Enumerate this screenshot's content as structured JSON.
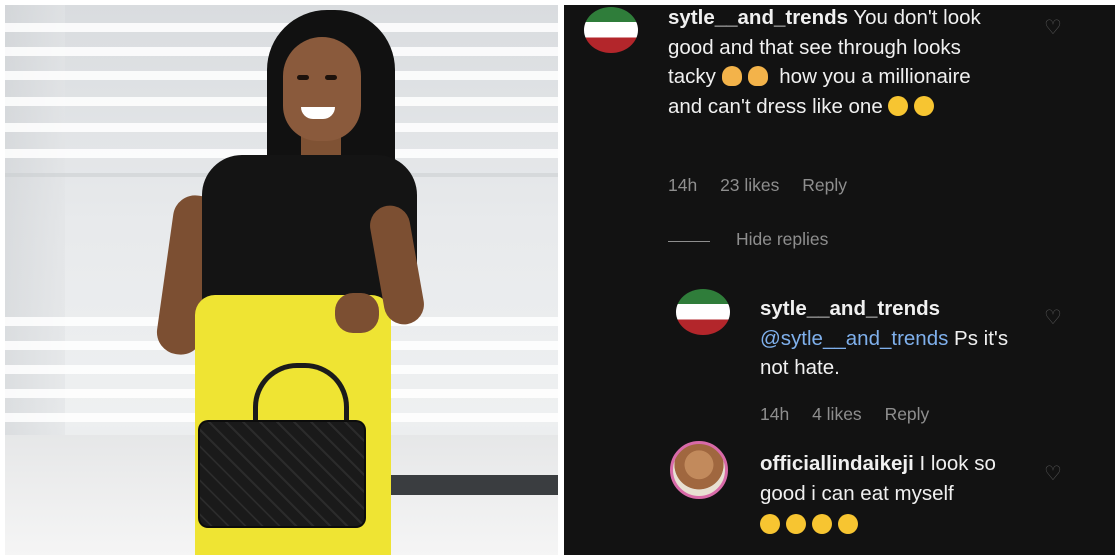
{
  "photo": {
    "alt": ""
  },
  "comments": [
    {
      "username": "sytle__and_trends",
      "text": "You don't look good and that see through looks tacky",
      "text_cont": "how you a millionaire and can't dress like one",
      "time": "14h",
      "likes": "23 likes",
      "reply": "Reply"
    },
    {
      "username": "sytle__and_trends",
      "mention": "@sytle__and_trends",
      "text": "Ps it's not hate.",
      "time": "14h",
      "likes": "4 likes",
      "reply": "Reply"
    },
    {
      "username": "officiallindaikeji",
      "text": "I look so good i can eat myself"
    }
  ],
  "hide_replies": "Hide replies",
  "icons": [
    "heart-icon",
    "face-palm-emoji",
    "crying-emoji",
    "rofl-emoji"
  ]
}
